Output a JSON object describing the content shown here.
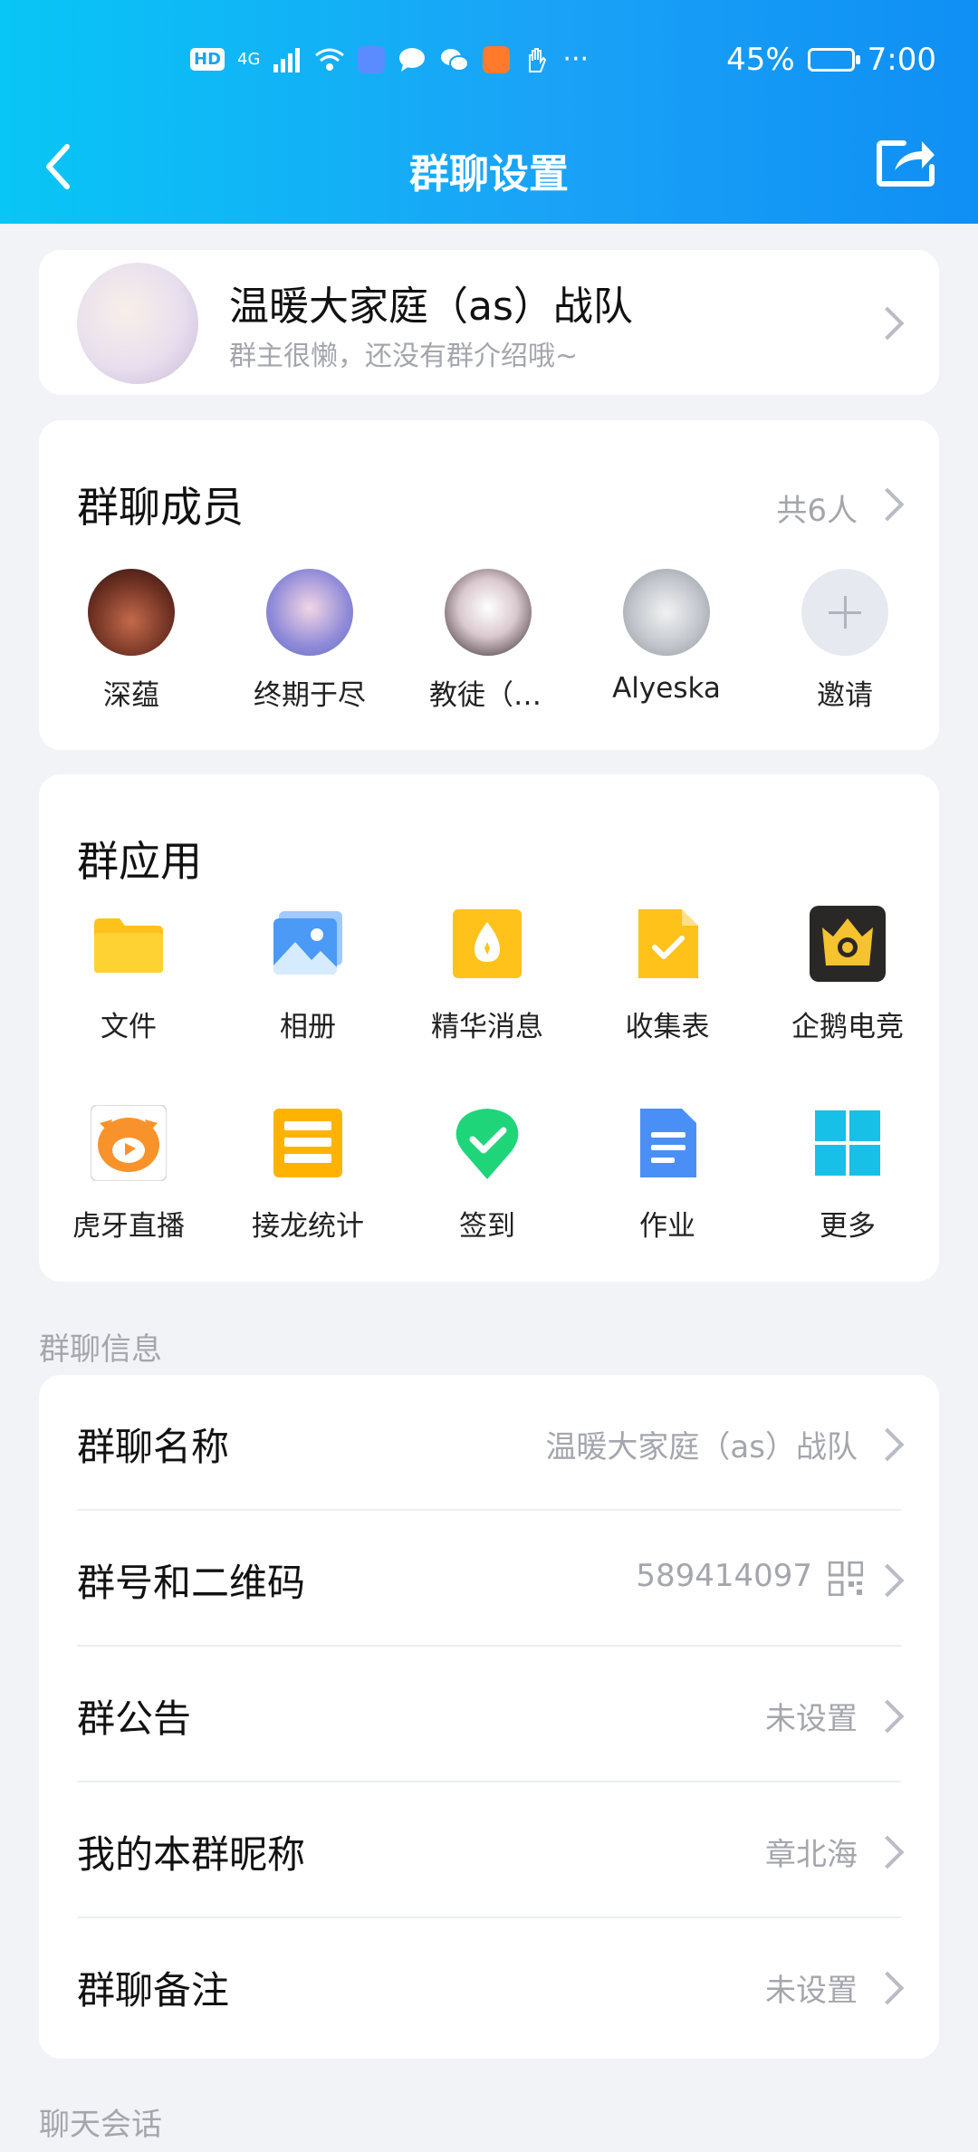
{
  "status_bar": {
    "battery_pct": "45%",
    "time": "7:00",
    "hd_label": "HD",
    "network_label": "4G"
  },
  "nav": {
    "title": "群聊设置"
  },
  "group_header": {
    "name": "温暖大家庭（as）战队",
    "intro": "群主很懒，还没有群介绍哦~"
  },
  "members": {
    "title": "群聊成员",
    "count": "共6人",
    "items": [
      {
        "name": "深蕴"
      },
      {
        "name": "终期于尽"
      },
      {
        "name": "教徒（1…"
      },
      {
        "name": "Alyeska"
      },
      {
        "name": "邀请"
      }
    ]
  },
  "apps": {
    "title": "群应用",
    "items": [
      {
        "label": "文件",
        "icon": "folder-icon"
      },
      {
        "label": "相册",
        "icon": "album-icon"
      },
      {
        "label": "精华消息",
        "icon": "essence-icon"
      },
      {
        "label": "收集表",
        "icon": "form-icon"
      },
      {
        "label": "企鹅电竞",
        "icon": "esports-icon"
      },
      {
        "label": "虎牙直播",
        "icon": "huya-icon"
      },
      {
        "label": "接龙统计",
        "icon": "chain-icon"
      },
      {
        "label": "签到",
        "icon": "checkin-icon"
      },
      {
        "label": "作业",
        "icon": "homework-icon"
      },
      {
        "label": "更多",
        "icon": "more-grid-icon"
      }
    ]
  },
  "group_info": {
    "section_label": "群聊信息",
    "rows": [
      {
        "label": "群聊名称",
        "value": "温暖大家庭（as）战队"
      },
      {
        "label": "群号和二维码",
        "value": "589414097"
      },
      {
        "label": "群公告",
        "value": "未设置"
      },
      {
        "label": "我的本群昵称",
        "value": "章北海"
      },
      {
        "label": "群聊备注",
        "value": "未设置"
      }
    ]
  },
  "chat_section": {
    "section_label": "聊天会话"
  },
  "colors": {
    "header_start": "#08c6f5",
    "header_end": "#0f8ff4",
    "page_bg": "#f2f3f7",
    "muted_text": "#a4a6ad"
  }
}
